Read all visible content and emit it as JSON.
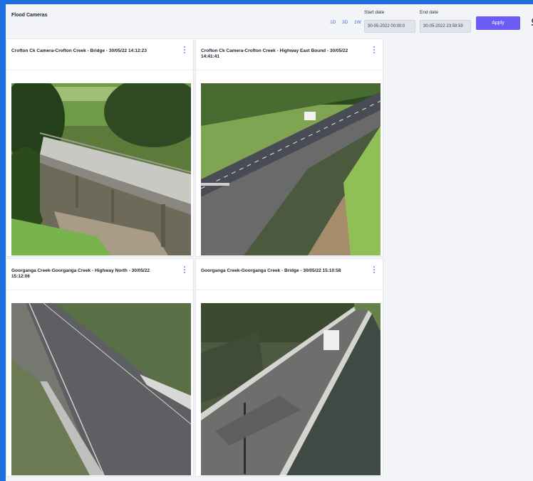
{
  "header": {
    "title": "Flood Cameras",
    "ranges": [
      "1D",
      "3D",
      "1W"
    ],
    "start_label": "Start date",
    "start_value": "30-05-2022 00:00:0",
    "end_label": "End date",
    "end_value": "30-05-2022 23:59:59",
    "apply_label": "Apply"
  },
  "cameras": [
    {
      "title": "Crofton Ck Camera-Crofton Creek - Bridge - 30/05/22 14:12:23"
    },
    {
      "title": "Crofton Ck Camera-Crofton Creek - Highway East Bound - 30/05/22 14:41:41"
    },
    {
      "title": "Goorganga Creek-Goorganga Creek - Highway North - 30/05/22 15:12:06"
    },
    {
      "title": "Goorganga Creek-Goorganga Creek - Bridge - 30/05/22 15:10:58"
    }
  ],
  "colors": {
    "accent": "#6b5cf5",
    "link": "#3d6be0",
    "frame": "#1e6fe0"
  }
}
